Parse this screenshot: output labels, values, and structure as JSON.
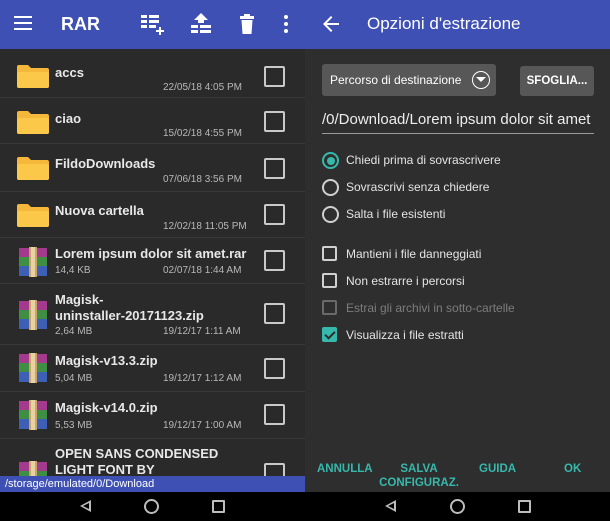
{
  "left": {
    "app_title": "RAR",
    "toolbar_icons": [
      "add-to-archive-icon",
      "extract-icon",
      "delete-icon",
      "more-vert-icon"
    ],
    "files": [
      {
        "name": "accs",
        "size": "",
        "date": "22/05/18 4:05 PM",
        "type": "folder"
      },
      {
        "name": "ciao",
        "size": "",
        "date": "15/02/18 4:55 PM",
        "type": "folder"
      },
      {
        "name": "FildoDownloads",
        "size": "",
        "date": "07/06/18 3:56 PM",
        "type": "folder"
      },
      {
        "name": "Nuova cartella",
        "size": "",
        "date": "12/02/18 11:05 PM",
        "type": "folder"
      },
      {
        "name": "Lorem ipsum dolor sit amet.rar",
        "size": "14,4 KB",
        "date": "02/07/18 1:44 AM",
        "type": "archive"
      },
      {
        "name": "Magisk-\nuninstaller-20171123.zip",
        "size": "2,64 MB",
        "date": "19/12/17 1:11 AM",
        "type": "archive"
      },
      {
        "name": "Magisk-v13.3.zip",
        "size": "5,04 MB",
        "date": "19/12/17 1:12 AM",
        "type": "archive"
      },
      {
        "name": "Magisk-v14.0.zip",
        "size": "5,53 MB",
        "date": "19/12/17 1:00 AM",
        "type": "archive"
      },
      {
        "name": "OPEN SANS CONDENSED\nLIGHT FONT BY",
        "size": "",
        "date": "",
        "type": "archive"
      }
    ],
    "current_path": "/storage/emulated/0/Download"
  },
  "right": {
    "title": "Opzioni d'estrazione",
    "destination_label": "Percorso di destinazione",
    "browse_label": "SFOGLIA...",
    "path_value": "/0/Download/Lorem ipsum dolor sit amet",
    "overwrite_options": [
      {
        "label": "Chiedi prima di sovrascrivere",
        "selected": true
      },
      {
        "label": "Sovrascrivi senza chiedere",
        "selected": false
      },
      {
        "label": "Salta i file esistenti",
        "selected": false
      }
    ],
    "checkbox_options": [
      {
        "label": "Mantieni i file danneggiati",
        "checked": false,
        "enabled": true
      },
      {
        "label": "Non estrarre i percorsi",
        "checked": false,
        "enabled": true
      },
      {
        "label": "Estrai gli archivi in sotto-cartelle",
        "checked": false,
        "enabled": false
      },
      {
        "label": "Visualizza i file estratti",
        "checked": true,
        "enabled": true
      }
    ],
    "actions": {
      "cancel": "ANNULLA",
      "save_config": "SALVA\nCONFIGURAZ.",
      "help": "GUIDA",
      "ok": "OK"
    }
  },
  "colors": {
    "toolbar": "#3e50b4",
    "accent": "#37b8ac",
    "panel_bg": "#2e2e2e",
    "list_bg": "#2a2a2a",
    "folder": "#f5b83b"
  },
  "nav_icons": [
    "back-icon",
    "home-icon",
    "recents-icon"
  ]
}
